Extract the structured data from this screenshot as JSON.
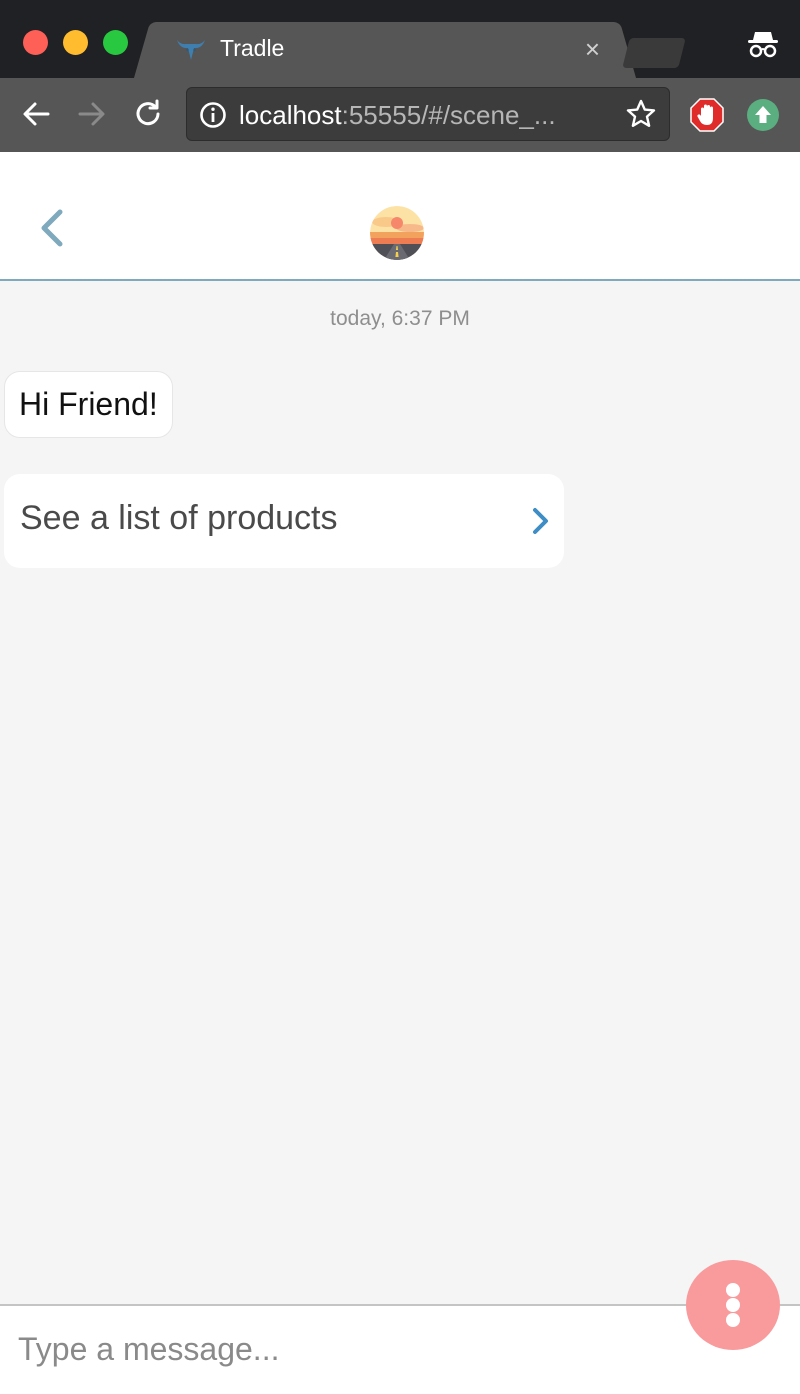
{
  "browser": {
    "tab": {
      "title": "Tradle",
      "favicon": "tradle-bull-icon",
      "close": "×"
    },
    "toolbar": {
      "back": "back-arrow-icon",
      "forward": "forward-arrow-icon",
      "reload": "reload-icon"
    },
    "omnibox": {
      "host": "localhost",
      "rest": ":55555/#/scene_...",
      "info_icon": "info-icon",
      "bookmark_icon": "star-icon"
    },
    "extensions": [
      "adblock-hand-icon",
      "upload-arrow-icon"
    ],
    "incognito": "incognito-icon"
  },
  "header": {
    "back_icon": "chevron-left-icon",
    "avatar": "road-sunset-avatar",
    "accent_color": "#7fa9bd"
  },
  "chat": {
    "timestamp": "today, 6:37 PM",
    "messages": [
      {
        "type": "text",
        "text": "Hi Friend!"
      },
      {
        "type": "action",
        "text": "See a list of products",
        "icon": "chevron-right-icon"
      }
    ]
  },
  "composer": {
    "placeholder": "Type a message...",
    "menu_icon": "more-vertical-icon",
    "menu_color": "#f99a9c"
  }
}
